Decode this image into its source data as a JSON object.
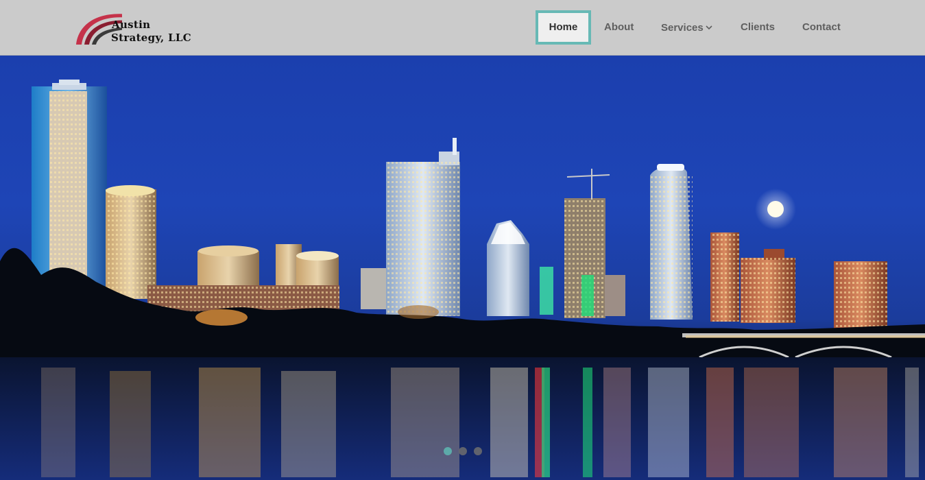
{
  "brand": {
    "logo_line1": "Austin",
    "logo_line2": "Strategy, LLC",
    "swoosh_colors": [
      "#c5324a",
      "#8a1e31",
      "#2b2b2b"
    ]
  },
  "nav": {
    "items": [
      {
        "label": "Home",
        "active": true
      },
      {
        "label": "About"
      },
      {
        "label": "Services",
        "icon": "chevron-down-icon"
      },
      {
        "label": "Clients"
      },
      {
        "label": "Contact"
      }
    ]
  },
  "hero": {
    "image": "austin-skyline-at-night",
    "slides": [
      {
        "active": true
      },
      {},
      {}
    ]
  },
  "colors": {
    "header_bg": "#cbcbcb",
    "accent": "#67b9b5",
    "nav_text": "#5f5f5f"
  }
}
